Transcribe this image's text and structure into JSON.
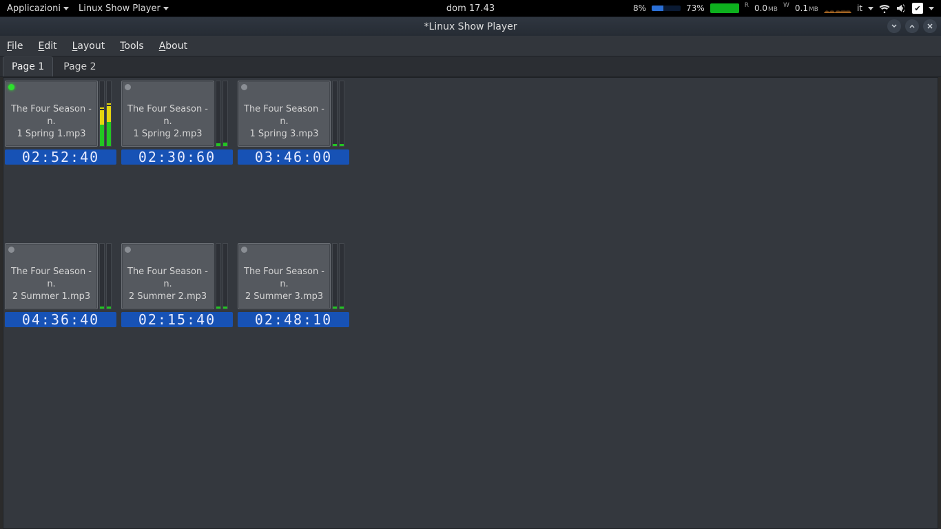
{
  "panel": {
    "apps_label": "Applicazioni",
    "app_label": "Linux Show Player",
    "clock": "dom 17.43",
    "cpu_pct": "8%",
    "mem_pct": "73%",
    "net": {
      "r_label": "R",
      "r_val": "0.0",
      "r_unit": "MB",
      "w_label": "W",
      "w_val": "0.1",
      "w_unit": "MB"
    },
    "lang": "it"
  },
  "window": {
    "title": "*Linux Show Player"
  },
  "menu": {
    "file": "File",
    "edit": "Edit",
    "layout": "Layout",
    "tools": "Tools",
    "about": "About"
  },
  "tabs": {
    "page1": "Page 1",
    "page2": "Page 2",
    "active": "page1"
  },
  "cues": {
    "row1": [
      {
        "line1": "The Four Season - n.",
        "line2": "1 Spring 1.mp3",
        "time": "02:52:40",
        "playing": true,
        "level_l": 55,
        "level_r": 62
      },
      {
        "line1": "The Four Season - n.",
        "line2": "1 Spring 2.mp3",
        "time": "02:30:60",
        "playing": false,
        "level_l": 4,
        "level_r": 5
      },
      {
        "line1": "The Four Season - n.",
        "line2": "1 Spring 3.mp3",
        "time": "03:46:00",
        "playing": false,
        "level_l": 3,
        "level_r": 3
      }
    ],
    "row2": [
      {
        "line1": "The Four Season - n.",
        "line2": "2 Summer 1.mp3",
        "time": "04:36:40",
        "playing": false,
        "level_l": 3,
        "level_r": 3
      },
      {
        "line1": "The Four Season - n.",
        "line2": "2 Summer 2.mp3",
        "time": "02:15:40",
        "playing": false,
        "level_l": 3,
        "level_r": 3
      },
      {
        "line1": "The Four Season - n.",
        "line2": "2 Summer 3.mp3",
        "time": "02:48:10",
        "playing": false,
        "level_l": 3,
        "level_r": 3
      }
    ]
  }
}
